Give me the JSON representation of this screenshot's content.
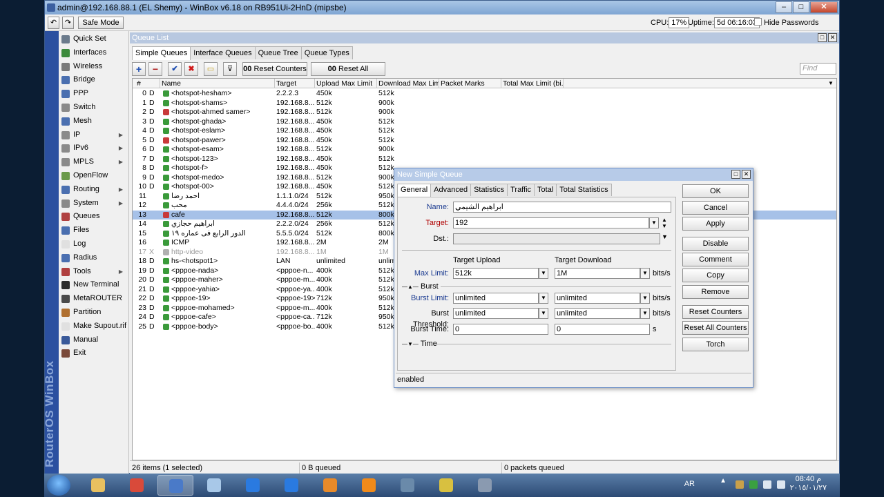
{
  "window": {
    "title": "admin@192.168.88.1 (EL Shemy) - WinBox v6.18 on RB951Ui-2HnD (mipsbe)"
  },
  "toolbar": {
    "undo": "↶",
    "redo": "↷",
    "safe_mode": "Safe Mode",
    "cpu_label": "CPU:",
    "cpu_value": "17%",
    "uptime_label": "Uptime:",
    "uptime_value": "5d 06:16:03",
    "hide_passwords": "Hide Passwords"
  },
  "side_label": "RouterOS WinBox",
  "menu": [
    {
      "label": "Quick Set",
      "icon": "quick-set-icon",
      "color": "#6b7b8c",
      "arrow": false
    },
    {
      "label": "Interfaces",
      "icon": "interfaces-icon",
      "color": "#3c8a3c",
      "arrow": false
    },
    {
      "label": "Wireless",
      "icon": "wireless-icon",
      "color": "#7a7a7a",
      "arrow": false
    },
    {
      "label": "Bridge",
      "icon": "bridge-icon",
      "color": "#4a6fb0",
      "arrow": false
    },
    {
      "label": "PPP",
      "icon": "ppp-icon",
      "color": "#4a6fb0",
      "arrow": false
    },
    {
      "label": "Switch",
      "icon": "switch-icon",
      "color": "#8a8a8a",
      "arrow": false
    },
    {
      "label": "Mesh",
      "icon": "mesh-icon",
      "color": "#4a6fb0",
      "arrow": false
    },
    {
      "label": "IP",
      "icon": "ip-icon",
      "color": "#8a8a8a",
      "arrow": true
    },
    {
      "label": "IPv6",
      "icon": "ipv6-icon",
      "color": "#8a8a8a",
      "arrow": true
    },
    {
      "label": "MPLS",
      "icon": "mpls-icon",
      "color": "#8a8a8a",
      "arrow": true
    },
    {
      "label": "OpenFlow",
      "icon": "openflow-icon",
      "color": "#6a9a4a",
      "arrow": false
    },
    {
      "label": "Routing",
      "icon": "routing-icon",
      "color": "#4a6fb0",
      "arrow": true
    },
    {
      "label": "System",
      "icon": "system-icon",
      "color": "#8a8a8a",
      "arrow": true
    },
    {
      "label": "Queues",
      "icon": "queues-icon",
      "color": "#b04040",
      "arrow": false
    },
    {
      "label": "Files",
      "icon": "files-icon",
      "color": "#4a6fb0",
      "arrow": false
    },
    {
      "label": "Log",
      "icon": "log-icon",
      "color": "#e0e0e0",
      "arrow": false
    },
    {
      "label": "Radius",
      "icon": "radius-icon",
      "color": "#4a6fb0",
      "arrow": false
    },
    {
      "label": "Tools",
      "icon": "tools-icon",
      "color": "#b04040",
      "arrow": true
    },
    {
      "label": "New Terminal",
      "icon": "terminal-icon",
      "color": "#2a2a2a",
      "arrow": false
    },
    {
      "label": "MetaROUTER",
      "icon": "metarouter-icon",
      "color": "#4a4a4a",
      "arrow": false
    },
    {
      "label": "Partition",
      "icon": "partition-icon",
      "color": "#b07030",
      "arrow": false
    },
    {
      "label": "Make Supout.rif",
      "icon": "supout-icon",
      "color": "#e0e0e0",
      "arrow": false
    },
    {
      "label": "Manual",
      "icon": "manual-icon",
      "color": "#3a5a9a",
      "arrow": false
    },
    {
      "label": "Exit",
      "icon": "exit-icon",
      "color": "#7a4a3a",
      "arrow": false
    }
  ],
  "queue_list": {
    "title": "Queue List",
    "tabs": [
      "Simple Queues",
      "Interface Queues",
      "Queue Tree",
      "Queue Types"
    ],
    "active_tab": 0,
    "reset_counters": "Reset Counters",
    "reset_all_counters": "Reset All Counters",
    "counter_prefix": "00",
    "find_placeholder": "Find",
    "columns": [
      "#",
      "Name",
      "Target",
      "Upload Max Limit",
      "Download Max Limit",
      "Packet Marks",
      "Total Max Limit (bi..."
    ],
    "rows": [
      {
        "num": "0",
        "flag": "D",
        "name": "<hotspot-hesham>",
        "target": "2.2.2.3",
        "up": "450k",
        "down": "512k",
        "icon": "green",
        "state": ""
      },
      {
        "num": "1",
        "flag": "D",
        "name": "<hotspot-shams>",
        "target": "192.168.8...",
        "up": "512k",
        "down": "900k",
        "icon": "green",
        "state": ""
      },
      {
        "num": "2",
        "flag": "D",
        "name": "<hotspot-ahmed samer>",
        "target": "192.168.8...",
        "up": "512k",
        "down": "900k",
        "icon": "red",
        "state": ""
      },
      {
        "num": "3",
        "flag": "D",
        "name": "<hotspot-ghada>",
        "target": "192.168.8...",
        "up": "450k",
        "down": "512k",
        "icon": "green",
        "state": ""
      },
      {
        "num": "4",
        "flag": "D",
        "name": "<hotspot-eslam>",
        "target": "192.168.8...",
        "up": "450k",
        "down": "512k",
        "icon": "green",
        "state": ""
      },
      {
        "num": "5",
        "flag": "D",
        "name": "<hotspot-pawer>",
        "target": "192.168.8...",
        "up": "450k",
        "down": "512k",
        "icon": "red",
        "state": ""
      },
      {
        "num": "6",
        "flag": "D",
        "name": "<hotspot-esam>",
        "target": "192.168.8...",
        "up": "512k",
        "down": "900k",
        "icon": "green",
        "state": ""
      },
      {
        "num": "7",
        "flag": "D",
        "name": "<hotspot-123>",
        "target": "192.168.8...",
        "up": "450k",
        "down": "512k",
        "icon": "green",
        "state": ""
      },
      {
        "num": "8",
        "flag": "D",
        "name": "<hotspot-f>",
        "target": "192.168.8...",
        "up": "450k",
        "down": "512k",
        "icon": "green",
        "state": ""
      },
      {
        "num": "9",
        "flag": "D",
        "name": "<hotspot-medo>",
        "target": "192.168.8...",
        "up": "512k",
        "down": "900k",
        "icon": "green",
        "state": ""
      },
      {
        "num": "10",
        "flag": "D",
        "name": "<hotspot-00>",
        "target": "192.168.8...",
        "up": "450k",
        "down": "512k",
        "icon": "green",
        "state": ""
      },
      {
        "num": "11",
        "flag": "",
        "name": "احمد رضا",
        "target": "1.1.1.0/24",
        "up": "512k",
        "down": "950k",
        "icon": "green",
        "state": ""
      },
      {
        "num": "12",
        "flag": "",
        "name": "محب",
        "target": "4.4.4.0/24",
        "up": "256k",
        "down": "512k",
        "icon": "green",
        "state": ""
      },
      {
        "num": "13",
        "flag": "",
        "name": "cafe",
        "target": "192.168.8...",
        "up": "512k",
        "down": "800k",
        "icon": "red",
        "state": "sel"
      },
      {
        "num": "14",
        "flag": "",
        "name": "ابراهيم حجازي",
        "target": "2.2.2.0/24",
        "up": "256k",
        "down": "512k",
        "icon": "green",
        "state": ""
      },
      {
        "num": "15",
        "flag": "",
        "name": "الدور الرابع فى عماره ١٩",
        "target": "5.5.5.0/24",
        "up": "512k",
        "down": "800k",
        "icon": "green",
        "state": ""
      },
      {
        "num": "16",
        "flag": "",
        "name": "ICMP",
        "target": "192.168.8...",
        "up": "2M",
        "down": "2M",
        "icon": "green",
        "state": ""
      },
      {
        "num": "17",
        "flag": "X",
        "name": "http-video",
        "target": "192.168.8...",
        "up": "1M",
        "down": "1M",
        "icon": "gray",
        "state": "dis"
      },
      {
        "num": "18",
        "flag": "D",
        "name": "hs-<hotspot1>",
        "target": "LAN",
        "up": "unlimited",
        "down": "unlimited",
        "icon": "green",
        "state": ""
      },
      {
        "num": "19",
        "flag": "D",
        "name": "<pppoe-nada>",
        "target": "<pppoe-n...",
        "up": "400k",
        "down": "512k",
        "icon": "green",
        "state": ""
      },
      {
        "num": "20",
        "flag": "D",
        "name": "<pppoe-maher>",
        "target": "<pppoe-m...",
        "up": "400k",
        "down": "512k",
        "icon": "green",
        "state": ""
      },
      {
        "num": "21",
        "flag": "D",
        "name": "<pppoe-yahia>",
        "target": "<pppoe-ya...",
        "up": "400k",
        "down": "512k",
        "icon": "green",
        "state": ""
      },
      {
        "num": "22",
        "flag": "D",
        "name": "<pppoe-19>",
        "target": "<pppoe-19>",
        "up": "712k",
        "down": "950k",
        "icon": "green",
        "state": ""
      },
      {
        "num": "23",
        "flag": "D",
        "name": "<pppoe-mohamed>",
        "target": "<pppoe-m...",
        "up": "400k",
        "down": "512k",
        "icon": "green",
        "state": ""
      },
      {
        "num": "24",
        "flag": "D",
        "name": "<pppoe-cafe>",
        "target": "<pppoe-ca...",
        "up": "712k",
        "down": "950k",
        "icon": "green",
        "state": ""
      },
      {
        "num": "25",
        "flag": "D",
        "name": "<pppoe-body>",
        "target": "<pppoe-bo...",
        "up": "400k",
        "down": "512k",
        "icon": "green",
        "state": ""
      }
    ],
    "status": {
      "items": "26 items (1 selected)",
      "queued": "0 B queued",
      "packets": "0 packets queued"
    }
  },
  "dialog": {
    "title": "New Simple Queue",
    "tabs": [
      "General",
      "Advanced",
      "Statistics",
      "Traffic",
      "Total",
      "Total Statistics"
    ],
    "active_tab": 0,
    "name_label": "Name:",
    "name_value": "ابراهيم الشيمي",
    "target_label": "Target:",
    "target_value": "192",
    "dst_label": "Dst.:",
    "dst_value": "",
    "target_upload": "Target Upload",
    "target_download": "Target Download",
    "max_limit_label": "Max Limit:",
    "max_up": "512k",
    "max_down": "1M",
    "burst_section": "Burst",
    "burst_limit_label": "Burst Limit:",
    "burst_limit_up": "unlimited",
    "burst_limit_down": "unlimited",
    "burst_threshold_label": "Burst Threshold:",
    "burst_threshold_up": "unlimited",
    "burst_threshold_down": "unlimited",
    "burst_time_label": "Burst Time:",
    "burst_time_up": "0",
    "burst_time_down": "0",
    "time_section": "Time",
    "bits_unit": "bits/s",
    "s_unit": "s",
    "buttons": [
      "OK",
      "Cancel",
      "Apply",
      "Disable",
      "Comment",
      "Copy",
      "Remove",
      "Reset Counters",
      "Reset All Counters",
      "Torch"
    ],
    "status": "enabled"
  },
  "taskbar": {
    "lang": "AR",
    "time": "08:40 م",
    "date": "٢٠١٥/٠١/٢٧",
    "apps": [
      {
        "name": "explorer-icon",
        "color": "#e8c060",
        "active": false
      },
      {
        "name": "chrome-icon",
        "color": "#d94a3a",
        "active": false
      },
      {
        "name": "winbox-icon",
        "color": "#4a7ac8",
        "active": true
      },
      {
        "name": "notes-icon",
        "color": "#a8c8e8",
        "active": false
      },
      {
        "name": "teamviewer-icon",
        "color": "#2a7ae0",
        "active": false
      },
      {
        "name": "teamviewer2-icon",
        "color": "#2a7ae0",
        "active": false
      },
      {
        "name": "outlook-icon",
        "color": "#e88a2a",
        "active": false
      },
      {
        "name": "vlc-icon",
        "color": "#f08a1a",
        "active": false
      },
      {
        "name": "network-icon",
        "color": "#6a8aaa",
        "active": false
      },
      {
        "name": "lock-icon",
        "color": "#d8c040",
        "active": false
      },
      {
        "name": "dashboard-icon",
        "color": "#8a9ab0",
        "active": false
      }
    ]
  }
}
